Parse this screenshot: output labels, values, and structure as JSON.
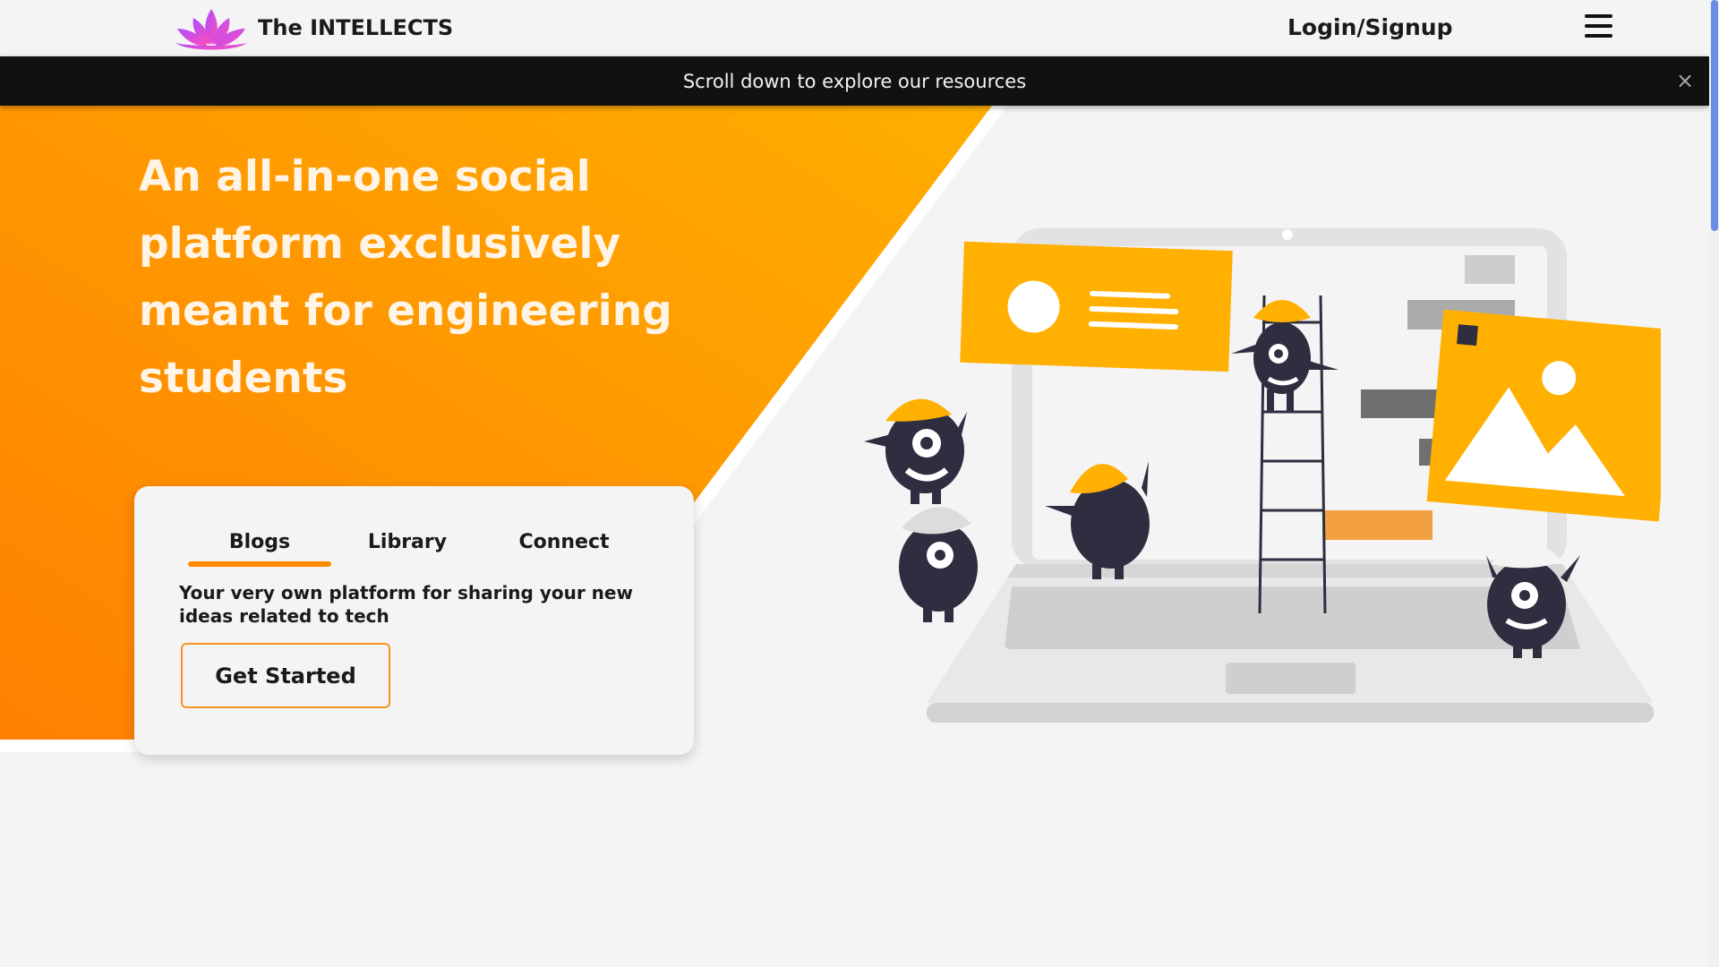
{
  "header": {
    "brand_name": "The INTELLECTS",
    "logo_icon": "lotus-icon",
    "login_label": "Login/Signup",
    "menu_icon": "hamburger-menu-icon"
  },
  "banner": {
    "message": "Scroll down to explore our resources",
    "close_label": "×"
  },
  "hero": {
    "headline": "An all-in-one social platform exclusively meant for engineering students"
  },
  "card": {
    "tabs": [
      {
        "label": "Blogs",
        "active": true
      },
      {
        "label": "Library",
        "active": false
      },
      {
        "label": "Connect",
        "active": false
      }
    ],
    "description": "Your very own platform for sharing your new ideas related to tech",
    "cta_label": "Get Started"
  },
  "colors": {
    "accent": "#ff8a00",
    "accent_light": "#ffb000",
    "banner_bg": "#111111",
    "background": "#f4f4f4",
    "figure_dark": "#2f2e41",
    "scrollbar": "#6b8be8"
  }
}
